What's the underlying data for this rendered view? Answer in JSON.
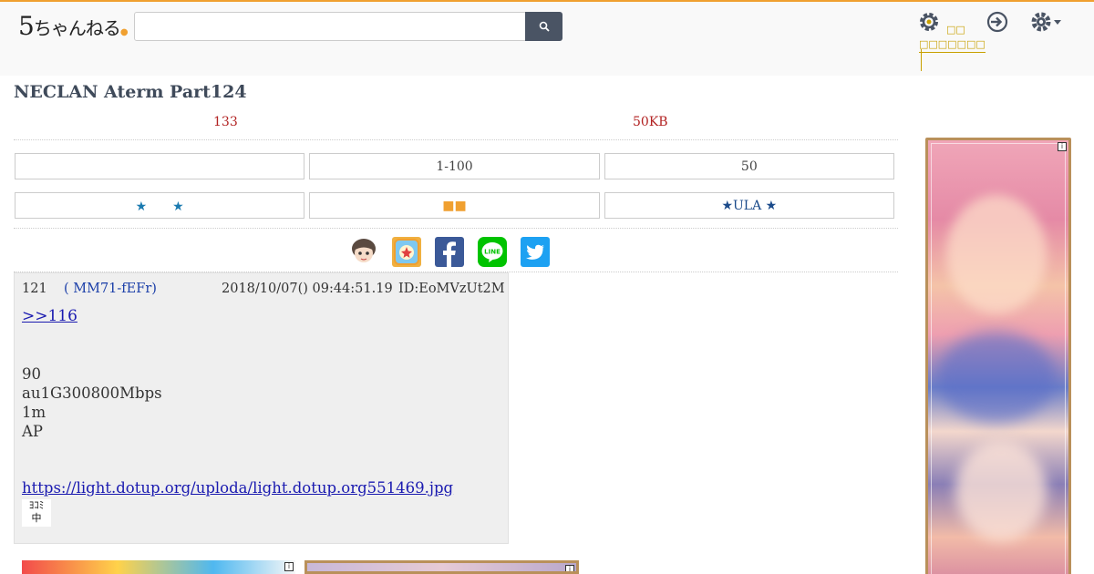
{
  "header": {
    "logo_main": "5",
    "logo_text": "ちゃんねる",
    "search_placeholder": "",
    "mini_label_1": "□□",
    "mini_label_2": "□□□□□□□"
  },
  "thread": {
    "title": "NECLAN Aterm Part124",
    "res_count": "133",
    "size": "50KB"
  },
  "nav_row_1": [
    "",
    "1-100",
    "50"
  ],
  "nav_row_2": [
    "★　　★",
    "■■",
    "★ULA ★"
  ],
  "share": [
    "avatar-share",
    "bookmark-share",
    "facebook",
    "line",
    "twitter"
  ],
  "post": {
    "number": "121",
    "name": "( MM71-fEFr)",
    "date": "2018/10/07() 09:44:51.19",
    "id": "ID:EoMVzUt2M",
    "anchor": ">>116",
    "body_lines": [
      "90",
      "au1G300800Mbps",
      "1m",
      "AP"
    ],
    "link": "https://light.dotup.org/uploda/light.dotup.org551469.jpg",
    "thumb_line_1": "ﾖｺﾐ",
    "thumb_line_2": "中"
  },
  "ads": {
    "badge": "i"
  },
  "colors": {
    "accent": "#f0a030",
    "search_button": "#4a5464",
    "title": "#3f4a5a",
    "count": "#b22222",
    "name": "#1a3ea8",
    "link": "#1a1ab0",
    "gold": "#c8a000",
    "facebook": "#3b5998",
    "line": "#00c300",
    "twitter": "#1da1f2"
  }
}
